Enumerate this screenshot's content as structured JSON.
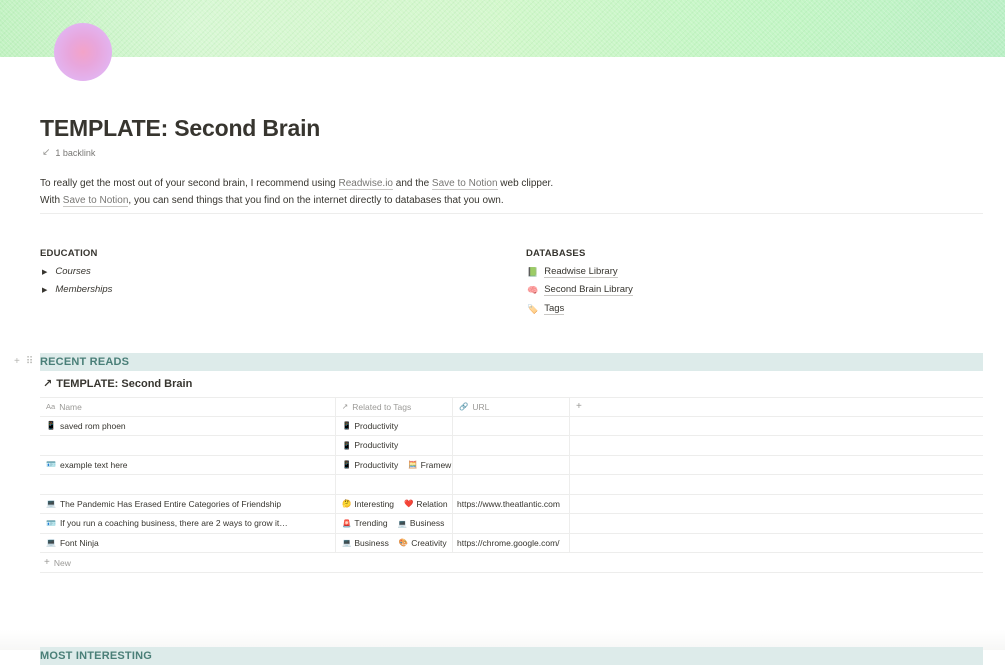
{
  "page": {
    "title": "TEMPLATE: Second Brain",
    "backlink": "1 backlink",
    "intro_1_a": "To really get the most out of your second brain, I recommend using ",
    "intro_1_link1": "Readwise.io",
    "intro_1_b": " and the ",
    "intro_1_link2": "Save to Notion",
    "intro_1_c": " web clipper.",
    "intro_2_a": "With ",
    "intro_2_link": "Save to Notion",
    "intro_2_b": ", you can send things that you find on the internet directly to databases that you own."
  },
  "education": {
    "heading": "EDUCATION",
    "items": [
      {
        "label": "Courses"
      },
      {
        "label": "Memberships"
      }
    ]
  },
  "databases": {
    "heading": "DATABASES",
    "items": [
      {
        "emoji": "📗",
        "label": "Readwise Library"
      },
      {
        "emoji": "🧠",
        "label": "Second Brain Library"
      },
      {
        "emoji": "🏷️",
        "label": "Tags"
      }
    ]
  },
  "recent_reads": {
    "heading": "RECENT READS",
    "linked_db_arrow": "↗",
    "linked_db_title": "TEMPLATE: Second Brain",
    "columns": {
      "name": "Name",
      "name_icon": "Aa",
      "tags": "Related to Tags",
      "tags_icon": "↗",
      "url": "URL",
      "url_icon": "🔗",
      "add": "+"
    },
    "rows": [
      {
        "icon": "📱",
        "name": "saved rom phoen",
        "tags": [
          {
            "e": "📱",
            "t": "Productivity"
          }
        ],
        "url": ""
      },
      {
        "icon": "",
        "name": "",
        "tags": [
          {
            "e": "📱",
            "t": "Productivity"
          }
        ],
        "url": ""
      },
      {
        "icon": "🪪",
        "name": "example text here",
        "tags": [
          {
            "e": "📱",
            "t": "Productivity"
          },
          {
            "e": "🧮",
            "t": "Framew"
          }
        ],
        "url": ""
      },
      {
        "icon": "",
        "name": "",
        "tags": [],
        "url": ""
      },
      {
        "icon": "💻",
        "name": "The Pandemic Has Erased Entire Categories of Friendship",
        "tags": [
          {
            "e": "🤔",
            "t": "Interesting"
          },
          {
            "e": "❤️",
            "t": "Relation"
          }
        ],
        "url": "https://www.theatlantic.com"
      },
      {
        "icon": "🪪",
        "name": "If you run a coaching business, there are 2 ways to grow it…",
        "tags": [
          {
            "e": "🚨",
            "t": "Trending"
          },
          {
            "e": "💻",
            "t": "Business"
          }
        ],
        "url": ""
      },
      {
        "icon": "💻",
        "name": "Font Ninja",
        "tags": [
          {
            "e": "💻",
            "t": "Business"
          },
          {
            "e": "🎨",
            "t": "Creativity"
          }
        ],
        "url": "https://chrome.google.com/"
      }
    ],
    "new_label": "New",
    "new_icon": "+"
  },
  "most_interesting": {
    "heading": "MOST INTERESTING"
  },
  "colors": {
    "section_bar_bg": "#ddebea",
    "section_bar_text": "#4a7f78",
    "text": "#37352f",
    "muted": "#787774"
  }
}
